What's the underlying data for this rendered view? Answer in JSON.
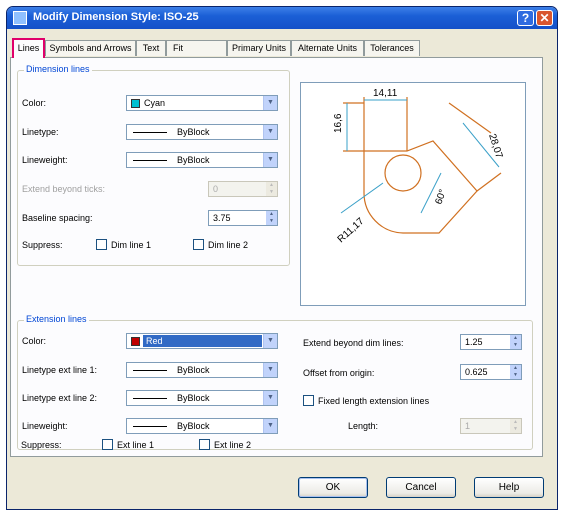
{
  "window": {
    "title": "Modify Dimension Style: ISO-25",
    "help_glyph": "?",
    "close_glyph": "✕"
  },
  "tabs": [
    {
      "label": "Lines"
    },
    {
      "label": "Symbols and Arrows"
    },
    {
      "label": "Text"
    },
    {
      "label": "Fit"
    },
    {
      "label": "Primary Units"
    },
    {
      "label": "Alternate Units"
    },
    {
      "label": "Tolerances"
    }
  ],
  "dimension_lines": {
    "group_title": "Dimension lines",
    "color": {
      "label": "Color:",
      "value": "Cyan",
      "swatch": "#00c0d0"
    },
    "linetype": {
      "label": "Linetype:",
      "value": "ByBlock"
    },
    "lineweight": {
      "label": "Lineweight:",
      "value": "ByBlock"
    },
    "extend_beyond_ticks": {
      "label": "Extend beyond ticks:",
      "value": "0"
    },
    "baseline_spacing": {
      "label": "Baseline spacing:",
      "value": "3.75"
    },
    "suppress": {
      "label": "Suppress:",
      "dim_line_1": "Dim line 1",
      "dim_line_2": "Dim line 2"
    }
  },
  "extension_lines": {
    "group_title": "Extension lines",
    "color": {
      "label": "Color:",
      "value": "Red",
      "swatch": "#c00000"
    },
    "linetype_ext1": {
      "label": "Linetype ext line 1:",
      "value": "ByBlock"
    },
    "linetype_ext2": {
      "label": "Linetype ext line 2:",
      "value": "ByBlock"
    },
    "lineweight": {
      "label": "Lineweight:",
      "value": "ByBlock"
    },
    "suppress": {
      "label": "Suppress:",
      "ext_line_1": "Ext line 1",
      "ext_line_2": "Ext line 2"
    },
    "extend_beyond_dim": {
      "label": "Extend beyond dim lines:",
      "value": "1.25"
    },
    "offset_from_origin": {
      "label": "Offset from origin:",
      "value": "0.625"
    },
    "fixed_length": {
      "label": "Fixed length extension lines"
    },
    "length": {
      "label": "Length:",
      "value": "1"
    }
  },
  "preview": {
    "dim_top": "14,11",
    "dim_left": "16,6",
    "dim_right": "28,07",
    "dim_radius": "R11,17",
    "dim_angle": "60°"
  },
  "buttons": {
    "ok": "OK",
    "cancel": "Cancel",
    "help": "Help"
  },
  "colors": {
    "accent_tab": "#e0006a",
    "title_blue": "#1b5fd6"
  }
}
